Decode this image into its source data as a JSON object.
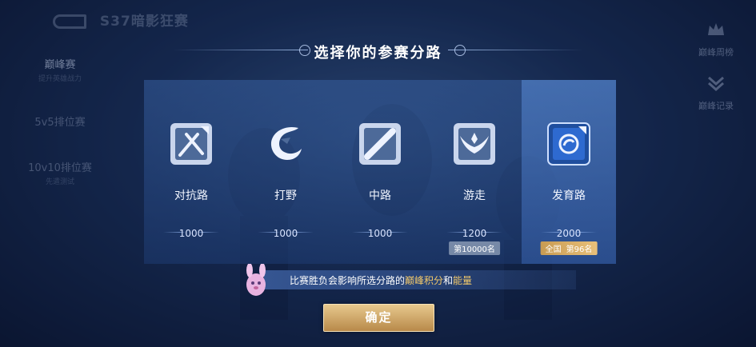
{
  "background": {
    "season_title": "S37暗影狂赛",
    "left_menu": [
      {
        "label": "巅峰赛",
        "sub": "提升英雄战力"
      },
      {
        "label": "5v5排位赛",
        "sub": ""
      },
      {
        "label": "10v10排位赛",
        "sub": "先遣测试"
      }
    ],
    "right_menu": [
      {
        "label": "巅峰周榜",
        "icon": "crown-icon"
      },
      {
        "label": "巅峰记录",
        "icon": "chevron-down-icon"
      }
    ]
  },
  "dialog": {
    "title": "选择你的参赛分路",
    "lanes": [
      {
        "name": "对抗路",
        "score": "1000",
        "rank": "",
        "icon": "crossed-swords-icon",
        "selected": false
      },
      {
        "name": "打野",
        "score": "1000",
        "rank": "",
        "icon": "dragon-icon",
        "selected": false
      },
      {
        "name": "中路",
        "score": "1000",
        "rank": "",
        "icon": "diagonal-slash-icon",
        "selected": false
      },
      {
        "name": "游走",
        "score": "1200",
        "rank": "第10000名",
        "icon": "wings-icon",
        "selected": false
      },
      {
        "name": "发育路",
        "score": "2000",
        "rank_region": "全国",
        "rank": "第96名",
        "icon": "swirl-icon",
        "selected": true
      }
    ],
    "note_prefix": "比赛胜负会影响所选分路的",
    "note_hl1": "巅峰积分",
    "note_mid": "和",
    "note_hl2": "能量",
    "confirm_label": "确定"
  },
  "colors": {
    "accent_gold": "#f3c96a",
    "selected_bg": "#5a8cd7",
    "confirm_bg": "#d4ad6b"
  }
}
